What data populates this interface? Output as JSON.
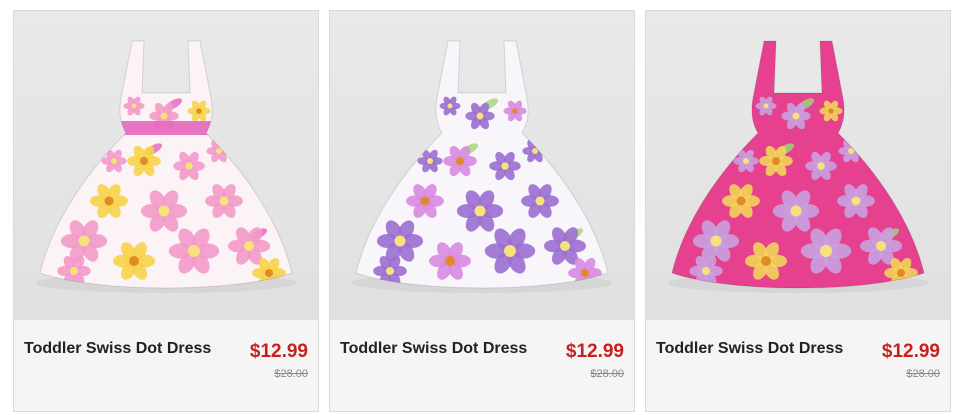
{
  "products": [
    {
      "name": "Toddler Swiss Dot Dress",
      "price": "$12.99",
      "old_price": "$28.00",
      "image": "pink-yellow-floral-dress-with-polka-dot-straps",
      "colors": {
        "base": "#fbf3f6",
        "flower1": "#f29ac9",
        "flower2": "#f7d348",
        "accent": "#e66cc0"
      }
    },
    {
      "name": "Toddler Swiss Dot Dress",
      "price": "$12.99",
      "old_price": "$28.00",
      "image": "white-purple-floral-dress",
      "colors": {
        "base": "#f8f6fb",
        "flower1": "#9b6fd0",
        "flower2": "#d88be0",
        "accent": "#a8d77c"
      }
    },
    {
      "name": "Toddler Swiss Dot Dress",
      "price": "$12.99",
      "old_price": "$28.00",
      "image": "hot-pink-floral-dress",
      "colors": {
        "base": "#e5418f",
        "flower1": "#c9a0e0",
        "flower2": "#f3d35a",
        "accent": "#9fd27a"
      }
    }
  ]
}
